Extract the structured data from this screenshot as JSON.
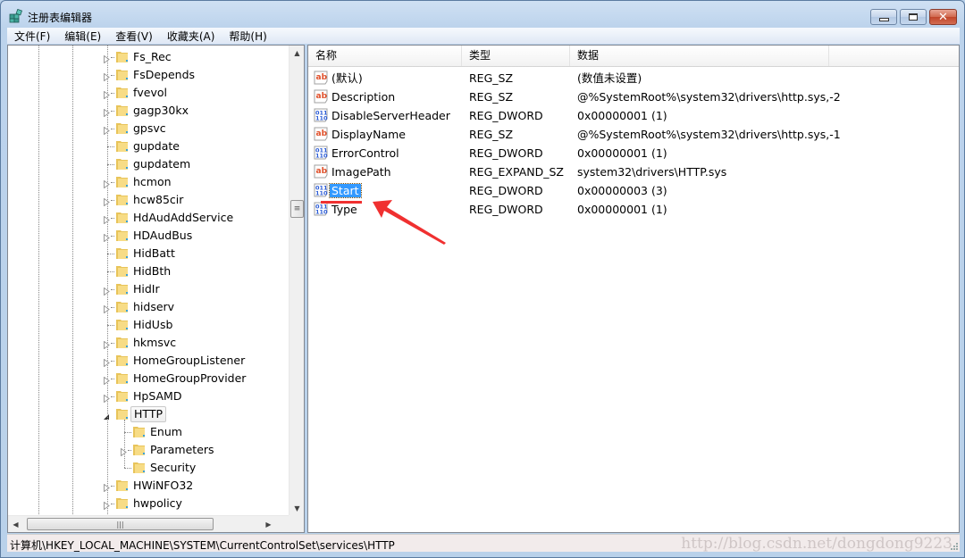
{
  "window": {
    "title": "注册表编辑器",
    "app_icon": "registry-editor-icon",
    "buttons": {
      "minimize": "minimize",
      "maximize": "maximize",
      "close": "close"
    }
  },
  "menu": [
    {
      "label": "文件(F)"
    },
    {
      "label": "编辑(E)"
    },
    {
      "label": "查看(V)"
    },
    {
      "label": "收藏夹(A)"
    },
    {
      "label": "帮助(H)"
    }
  ],
  "tree": {
    "items": [
      {
        "label": "Fs_Rec",
        "level": 0,
        "expander": "collapsed"
      },
      {
        "label": "FsDepends",
        "level": 0,
        "expander": "collapsed"
      },
      {
        "label": "fvevol",
        "level": 0,
        "expander": "collapsed"
      },
      {
        "label": "gagp30kx",
        "level": 0,
        "expander": "collapsed"
      },
      {
        "label": "gpsvc",
        "level": 0,
        "expander": "collapsed"
      },
      {
        "label": "gupdate",
        "level": 0,
        "expander": "none"
      },
      {
        "label": "gupdatem",
        "level": 0,
        "expander": "none"
      },
      {
        "label": "hcmon",
        "level": 0,
        "expander": "collapsed"
      },
      {
        "label": "hcw85cir",
        "level": 0,
        "expander": "collapsed"
      },
      {
        "label": "HdAudAddService",
        "level": 0,
        "expander": "collapsed"
      },
      {
        "label": "HDAudBus",
        "level": 0,
        "expander": "collapsed"
      },
      {
        "label": "HidBatt",
        "level": 0,
        "expander": "none"
      },
      {
        "label": "HidBth",
        "level": 0,
        "expander": "none"
      },
      {
        "label": "HidIr",
        "level": 0,
        "expander": "collapsed"
      },
      {
        "label": "hidserv",
        "level": 0,
        "expander": "collapsed"
      },
      {
        "label": "HidUsb",
        "level": 0,
        "expander": "none"
      },
      {
        "label": "hkmsvc",
        "level": 0,
        "expander": "collapsed"
      },
      {
        "label": "HomeGroupListener",
        "level": 0,
        "expander": "collapsed"
      },
      {
        "label": "HomeGroupProvider",
        "level": 0,
        "expander": "collapsed"
      },
      {
        "label": "HpSAMD",
        "level": 0,
        "expander": "collapsed"
      },
      {
        "label": "HTTP",
        "level": 0,
        "expander": "expanded",
        "selected": true
      },
      {
        "label": "Enum",
        "level": 1,
        "expander": "none"
      },
      {
        "label": "Parameters",
        "level": 1,
        "expander": "collapsed"
      },
      {
        "label": "Security",
        "level": 1,
        "expander": "none"
      },
      {
        "label": "HWiNFO32",
        "level": 0,
        "expander": "collapsed"
      },
      {
        "label": "hwpolicy",
        "level": 0,
        "expander": "collapsed"
      }
    ]
  },
  "list": {
    "columns": [
      "名称",
      "类型",
      "数据"
    ],
    "rows": [
      {
        "icon": "string-value-icon",
        "name": "(默认)",
        "type": "REG_SZ",
        "data": "(数值未设置)"
      },
      {
        "icon": "string-value-icon",
        "name": "Description",
        "type": "REG_SZ",
        "data": "@%SystemRoot%\\system32\\drivers\\http.sys,-2"
      },
      {
        "icon": "binary-value-icon",
        "name": "DisableServerHeader",
        "type": "REG_DWORD",
        "data": "0x00000001 (1)"
      },
      {
        "icon": "string-value-icon",
        "name": "DisplayName",
        "type": "REG_SZ",
        "data": "@%SystemRoot%\\system32\\drivers\\http.sys,-1"
      },
      {
        "icon": "binary-value-icon",
        "name": "ErrorControl",
        "type": "REG_DWORD",
        "data": "0x00000001 (1)"
      },
      {
        "icon": "string-value-icon",
        "name": "ImagePath",
        "type": "REG_EXPAND_SZ",
        "data": "system32\\drivers\\HTTP.sys"
      },
      {
        "icon": "binary-value-icon",
        "name": "Start",
        "type": "REG_DWORD",
        "data": "0x00000003 (3)",
        "selected": true
      },
      {
        "icon": "binary-value-icon",
        "name": "Type",
        "type": "REG_DWORD",
        "data": "0x00000001 (1)"
      }
    ]
  },
  "status": {
    "path": "计算机\\HKEY_LOCAL_MACHINE\\SYSTEM\\CurrentControlSet\\services\\HTTP",
    "watermark": "http://blog.csdn.net/dongdong9223"
  },
  "annotation": {
    "color": "#f03030",
    "target": "Start"
  },
  "colors": {
    "selection": "#3399ff",
    "string_icon": "#e0502a",
    "binary_icon": "#2a5bd6",
    "folder": "#f2d36b"
  }
}
